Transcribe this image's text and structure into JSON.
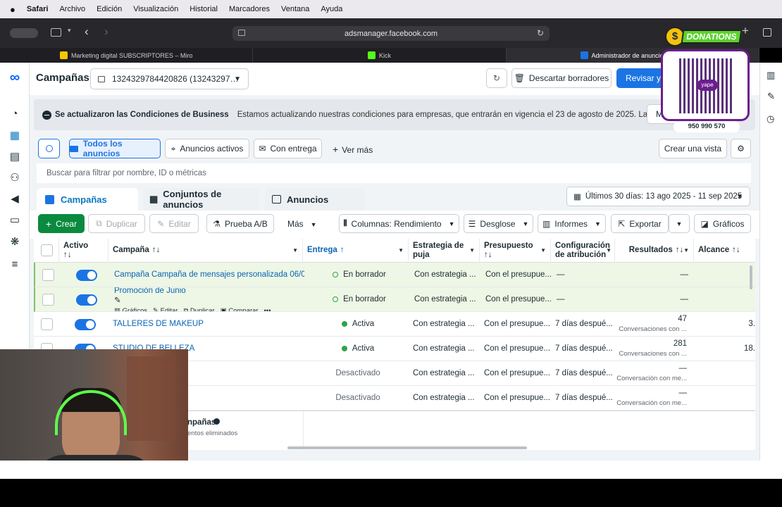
{
  "menubar": {
    "apple": "",
    "items": [
      "Safari",
      "Archivo",
      "Edición",
      "Visualización",
      "Historial",
      "Marcadores",
      "Ventana",
      "Ayuda"
    ]
  },
  "browser": {
    "url": "adsmanager.facebook.com",
    "tabs": [
      {
        "label": "Marketing digital SUBSCRIPTORES – Miro",
        "icon_color": "#f7c600"
      },
      {
        "label": "Kick",
        "icon_color": "#53fc18"
      },
      {
        "label": "Administrador de anuncios - Adm",
        "icon_color": "#1b74e4"
      }
    ]
  },
  "header": {
    "title": "Campañas",
    "account": "1324329784420826 (13243297…",
    "discard": "Descartar borradores",
    "review": "Revisar y p"
  },
  "notice": {
    "title": "Se actualizaron las Condiciones de Business",
    "text": "Estamos actualizando nuestras condiciones para empresas, que entrarán en vigencia el 23 de agosto de 2025. Las condicio...",
    "button": "M"
  },
  "filters": {
    "all": "Todos los anuncios",
    "active": "Anuncios activos",
    "delivery": "Con entrega",
    "more": "Ver más",
    "create_view": "Crear una vista"
  },
  "search": {
    "placeholder": "Buscar para filtrar por nombre, ID o métricas"
  },
  "panel_tabs": {
    "campaigns": "Campañas",
    "adsets": "Conjuntos de anuncios",
    "ads": "Anuncios",
    "date_range": "Últimos 30 días: 13 ago 2025 - 11 sep 2025"
  },
  "actions": {
    "create": "Crear",
    "duplicate": "Duplicar",
    "edit": "Editar",
    "ab": "Prueba A/B",
    "more": "Más",
    "columns": "Columnas: Rendimiento",
    "breakdown": "Desglose",
    "reports": "Informes",
    "export": "Exportar",
    "charts": "Gráficos"
  },
  "columns": {
    "active": "Activo",
    "campaign": "Campaña",
    "delivery": "Entrega",
    "bid": "Estrategia de puja",
    "budget": "Presupuesto",
    "attribution": "Configuración de atribución",
    "results": "Resultados",
    "reach": "Alcance"
  },
  "rows": [
    {
      "name": "Campaña Campaña de mensajes personalizada 06/0…",
      "delivery": "En borrador",
      "dot": "outline",
      "bid": "Con estrategia ...",
      "budget": "Con el presupue...",
      "attribution": "—",
      "results": "—",
      "results_sub": "",
      "reach": "",
      "draft": true
    },
    {
      "name": "Promoción de Junio",
      "delivery": "En borrador",
      "dot": "outline",
      "bid": "Con estrategia ...",
      "budget": "Con el presupue...",
      "attribution": "—",
      "results": "—",
      "results_sub": "",
      "reach": "",
      "draft": true
    },
    {
      "name": "TALLERES DE MAKEUP",
      "delivery": "Activa",
      "dot": "green",
      "bid": "Con estrategia ...",
      "budget": "Con el presupue...",
      "attribution": "7 días despué...",
      "results": "47",
      "results_sub": "Conversaciones con ...",
      "reach": "3.",
      "draft": false
    },
    {
      "name": "STUDIO DE BELLEZA",
      "delivery": "Activa",
      "dot": "green",
      "bid": "Con estrategia ...",
      "budget": "Con el presupue...",
      "attribution": "7 días despué...",
      "results": "281",
      "results_sub": "Conversaciones con ...",
      "reach": "18.",
      "draft": false
    },
    {
      "name": "",
      "delivery": "Desactivado",
      "dot": "none",
      "bid": "Con estrategia ...",
      "budget": "Con el presupue...",
      "attribution": "7 días despué...",
      "results": "—",
      "results_sub": "Conversación con me...",
      "reach": "",
      "draft": false
    },
    {
      "name": "",
      "delivery": "Desactivado",
      "dot": "none",
      "bid": "Con estrategia ...",
      "budget": "Con el presupue...",
      "attribution": "7 días despué...",
      "results": "—",
      "results_sub": "Conversación con me...",
      "reach": "",
      "draft": false
    }
  ],
  "row_hover_actions": {
    "charts": "Gráficos",
    "edit": "Editar",
    "duplicate": "Duplicar",
    "compare": "Comparar"
  },
  "footer": {
    "title": "npañas",
    "sub": "entos eliminados"
  },
  "donation": {
    "label": "DONATIONS",
    "phone": "950 990 570",
    "brand": "yape"
  },
  "colors": {
    "accent": "#1b74e4",
    "create": "#0a8a3f",
    "active_dot": "#31a24c",
    "draft_bg": "#eef7e5"
  }
}
